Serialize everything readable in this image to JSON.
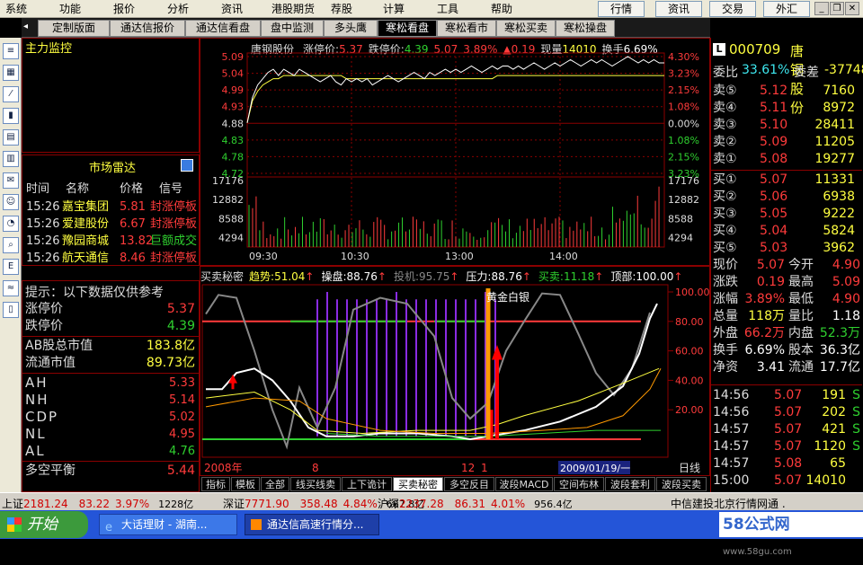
{
  "menu": {
    "items": [
      "系统",
      "功能",
      "报价",
      "分析",
      "资讯",
      "港股期货",
      "荐股",
      "计算",
      "工具",
      "帮助"
    ],
    "right_buttons": [
      "行情",
      "资讯",
      "交易",
      "外汇"
    ]
  },
  "tabs": [
    "定制版面",
    "通达信报价",
    "通达信看盘",
    "盘中监测",
    "多头鹰",
    "寒松看盘",
    "寒松看市",
    "寒松买卖",
    "寒松操盘"
  ],
  "active_tab": 5,
  "left_top": {
    "title": "主力监控"
  },
  "radar": {
    "title": "市场雷达",
    "headers": [
      "时间",
      "名称",
      "价格",
      "信号"
    ],
    "rows": [
      {
        "time": "15:26",
        "name": "嘉宝集团",
        "price": "5.81",
        "signal": "封涨停板",
        "sig_color": "#ff3b3b"
      },
      {
        "time": "15:26",
        "name": "爱建股份",
        "price": "6.67",
        "signal": "封涨停板",
        "sig_color": "#ff3b3b"
      },
      {
        "time": "15:26",
        "name": "豫园商城",
        "price": "13.82",
        "signal": "巨额成交",
        "sig_color": "#2fd02f"
      },
      {
        "time": "15:26",
        "name": "航天通信",
        "price": "8.46",
        "signal": "封涨停板",
        "sig_color": "#ff3b3b"
      }
    ]
  },
  "tips": {
    "title": "提示：以下数据仅供参考",
    "limit": [
      {
        "label": "涨停价",
        "value": "5.37",
        "color": "#ff3b3b"
      },
      {
        "label": "跌停价",
        "value": "4.39",
        "color": "#2fd02f"
      }
    ],
    "cap": [
      {
        "label": "AB股总市值",
        "value": "183.8",
        "unit": "亿"
      },
      {
        "label": "流通市值",
        "value": "89.73",
        "unit": "亿"
      }
    ],
    "lines": [
      {
        "label": "AH",
        "value": "5.33",
        "color": "#ff3b3b"
      },
      {
        "label": "NH",
        "value": "5.14",
        "color": "#ff3b3b"
      },
      {
        "label": "CDP",
        "value": "5.02",
        "color": "#ff3b3b"
      },
      {
        "label": "NL",
        "value": "4.95",
        "color": "#ff3b3b"
      },
      {
        "label": "AL",
        "value": "4.76",
        "color": "#2fd02f"
      }
    ],
    "balance": {
      "label": "多空平衡",
      "value": "5.44"
    }
  },
  "intraday": {
    "name": "唐钢股份",
    "header_items": [
      {
        "label": "涨停价:",
        "value": "5.37",
        "color": "#ff3b3b"
      },
      {
        "label": "跌停价:",
        "value": "4.39",
        "color": "#2fd02f"
      },
      {
        "label": "",
        "value": "5.07",
        "color": "#ff3b3b"
      },
      {
        "label": "",
        "value": "3.89%",
        "color": "#ff3b3b"
      },
      {
        "label": "▲",
        "value": "0.19",
        "color": "#ff3b3b"
      },
      {
        "label": "现量",
        "value": "14010",
        "color": "#ffff40"
      },
      {
        "label": "换手",
        "value": "6.69%",
        "color": "#fff"
      }
    ],
    "price_left": [
      "5.09",
      "5.04",
      "4.99",
      "4.93",
      "4.88",
      "4.83",
      "4.78",
      "4.72"
    ],
    "price_right": [
      "4.30%",
      "3.23%",
      "2.15%",
      "1.08%",
      "0.00%",
      "1.08%",
      "2.15%",
      "3.23%"
    ],
    "vol_labels": [
      "17176",
      "12882",
      "8588",
      "4294"
    ],
    "time_labels": [
      "09:30",
      "10:30",
      "13:00",
      "14:00"
    ],
    "price_x": [
      0,
      3,
      6,
      9,
      12,
      15,
      18,
      21,
      24,
      27,
      30,
      33,
      36,
      39,
      42,
      45,
      48,
      51,
      54,
      57,
      60,
      63,
      66,
      69,
      72,
      75,
      78,
      81,
      84,
      87,
      90,
      93,
      96,
      99,
      102,
      105,
      108,
      111,
      114,
      117,
      120,
      123,
      126,
      129,
      132,
      135,
      138,
      141,
      144,
      147,
      150,
      153,
      156,
      159,
      162,
      165,
      168,
      171,
      174,
      177,
      180,
      183,
      186,
      189,
      192,
      195,
      198,
      201,
      204,
      207,
      210,
      213,
      216,
      219,
      222,
      225,
      228,
      231,
      234,
      237,
      240
    ],
    "price_y": [
      4.88,
      4.96,
      5.0,
      5.02,
      5.04,
      5.05,
      5.03,
      5.05,
      5.04,
      5.03,
      5.05,
      5.04,
      5.03,
      5.02,
      5.01,
      5.02,
      5.03,
      5.01,
      5.0,
      5.02,
      5.01,
      5.02,
      5.01,
      5.02,
      5.0,
      5.01,
      5.02,
      5.03,
      5.02,
      5.01,
      5.02,
      5.03,
      5.04,
      5.03,
      5.02,
      5.04,
      5.03,
      5.04,
      5.05,
      5.04,
      5.05,
      5.04,
      5.05,
      5.06,
      5.05,
      5.04,
      5.05,
      5.06,
      5.05,
      5.06,
      5.06,
      5.05,
      5.06,
      5.05,
      5.06,
      5.07,
      5.06,
      5.05,
      5.06,
      5.07,
      5.06,
      5.07,
      5.08,
      5.07,
      5.06,
      5.07,
      5.08,
      5.07,
      5.08,
      5.07,
      5.06,
      5.07,
      5.08,
      5.09,
      5.08,
      5.07,
      5.08,
      5.07,
      5.08,
      5.07,
      5.07
    ],
    "avg_y": [
      4.88,
      4.95,
      4.98,
      5.0,
      5.01,
      5.02,
      5.02,
      5.03,
      5.03,
      5.03,
      5.03,
      5.03,
      5.03,
      5.03,
      5.03,
      5.03,
      5.03,
      5.03,
      5.03,
      5.02,
      5.02,
      5.02,
      5.02,
      5.02,
      5.02,
      5.02,
      5.02,
      5.02,
      5.02,
      5.02,
      5.02,
      5.02,
      5.02,
      5.02,
      5.02,
      5.02,
      5.02,
      5.02,
      5.02,
      5.02,
      5.02,
      5.02,
      5.02,
      5.02,
      5.02,
      5.02,
      5.02,
      5.02,
      5.03,
      5.03,
      5.03,
      5.03,
      5.03,
      5.03,
      5.03,
      5.03,
      5.03,
      5.03,
      5.03,
      5.03,
      5.03,
      5.03,
      5.03,
      5.03,
      5.03,
      5.03,
      5.03,
      5.03,
      5.03,
      5.03,
      5.03,
      5.03,
      5.03,
      5.03,
      5.03,
      5.03,
      5.03,
      5.03,
      5.03,
      5.03,
      5.03
    ]
  },
  "indicator": {
    "name": "买卖秘密",
    "items": [
      {
        "label": "趋势:",
        "value": "51.04",
        "color": "#ffff40",
        "arrow": "↑"
      },
      {
        "label": "操盘:",
        "value": "88.76",
        "color": "#fff",
        "arrow": "↑"
      },
      {
        "label": "投机:",
        "value": "95.75",
        "color": "#888",
        "arrow": "↑"
      },
      {
        "label": "压力:",
        "value": "88.76",
        "color": "#fff",
        "arrow": "↑"
      },
      {
        "label": "买卖:",
        "value": "11.18",
        "color": "#2fd02f",
        "arrow": "↑"
      },
      {
        "label": "顶部:",
        "value": "100.00",
        "color": "#fff",
        "arrow": "↑"
      }
    ],
    "y_labels": [
      "100.00",
      "80.00",
      "60.00",
      "40.00",
      "20.00"
    ],
    "annotation": "黄金白银",
    "date_labels": [
      "2008年",
      "8",
      "12",
      "1"
    ],
    "date_box": "2009/01/19/一",
    "period": "日线"
  },
  "indicator_tabs": [
    "指标",
    "模板",
    "全部",
    "线买线卖",
    "上下诡计",
    "买卖秘密",
    "多空反目",
    "波段MACD",
    "空间布林",
    "波段套利",
    "波段买卖"
  ],
  "active_ind_tab": 5,
  "quote": {
    "code": "000709",
    "name": "唐钢股份",
    "wei": {
      "l1": "委比",
      "v1": "33.61%",
      "l2": "委差",
      "v2": "-37748"
    },
    "sell": [
      {
        "label": "卖⑤",
        "price": "5.12",
        "vol": "7160"
      },
      {
        "label": "卖④",
        "price": "5.11",
        "vol": "8972"
      },
      {
        "label": "卖③",
        "price": "5.10",
        "vol": "28411"
      },
      {
        "label": "卖②",
        "price": "5.09",
        "vol": "11205"
      },
      {
        "label": "卖①",
        "price": "5.08",
        "vol": "19277"
      }
    ],
    "buy": [
      {
        "label": "买①",
        "price": "5.07",
        "vol": "11331"
      },
      {
        "label": "买②",
        "price": "5.06",
        "vol": "6938"
      },
      {
        "label": "买③",
        "price": "5.05",
        "vol": "9222"
      },
      {
        "label": "买④",
        "price": "5.04",
        "vol": "5824"
      },
      {
        "label": "买⑤",
        "price": "5.03",
        "vol": "3962"
      }
    ],
    "stats": [
      {
        "l1": "现价",
        "v1": "5.07",
        "c1": "#ff3b3b",
        "l2": "今开",
        "v2": "4.90",
        "c2": "#ff3b3b"
      },
      {
        "l1": "涨跌",
        "v1": "0.19",
        "c1": "#ff3b3b",
        "l2": "最高",
        "v2": "5.09",
        "c2": "#ff3b3b"
      },
      {
        "l1": "涨幅",
        "v1": "3.89%",
        "c1": "#ff3b3b",
        "l2": "最低",
        "v2": "4.90",
        "c2": "#ff3b3b"
      },
      {
        "l1": "总量",
        "v1": "118万",
        "c1": "#ffff40",
        "l2": "量比",
        "v2": "1.18",
        "c2": "#fff"
      },
      {
        "l1": "外盘",
        "v1": "66.2万",
        "c1": "#ff3b3b",
        "l2": "内盘",
        "v2": "52.3万",
        "c2": "#2fd02f"
      },
      {
        "l1": "换手",
        "v1": "6.69%",
        "c1": "#fff",
        "l2": "股本",
        "v2": "36.3亿",
        "c2": "#fff"
      },
      {
        "l1": "净资",
        "v1": "3.41",
        "c1": "#fff",
        "l2": "流通",
        "v2": "17.7亿",
        "c2": "#fff"
      }
    ],
    "ticks": [
      {
        "time": "14:56",
        "price": "5.07",
        "vol": "191",
        "side": "S"
      },
      {
        "time": "14:56",
        "price": "5.07",
        "vol": "202",
        "side": "S"
      },
      {
        "time": "14:57",
        "price": "5.07",
        "vol": "421",
        "side": "S"
      },
      {
        "time": "14:57",
        "price": "5.07",
        "vol": "1120",
        "side": "S"
      },
      {
        "time": "14:57",
        "price": "5.08",
        "vol": "65",
        "side": ""
      },
      {
        "time": "15:00",
        "price": "5.07",
        "vol": "14010",
        "side": ""
      }
    ]
  },
  "status": [
    {
      "name": "上证",
      "value": "2181.24",
      "chg": "83.22",
      "pct": "3.97%",
      "amt": "1228亿"
    },
    {
      "name": "深证",
      "value": "7771.90",
      "chg": "358.48",
      "pct": "4.84%",
      "amt": "667.8亿"
    },
    {
      "name": "沪深",
      "value": "2237.28",
      "chg": "86.31",
      "pct": "4.01%",
      "amt": "956.4亿"
    }
  ],
  "status_right": "中信建投北京行情网通 .",
  "taskbar": {
    "start": "开始",
    "tasks": [
      "大话理财 - 湖南...",
      "通达信高速行情分..."
    ],
    "watermark": "58公式网",
    "watermark_url": "www.58gu.com"
  }
}
